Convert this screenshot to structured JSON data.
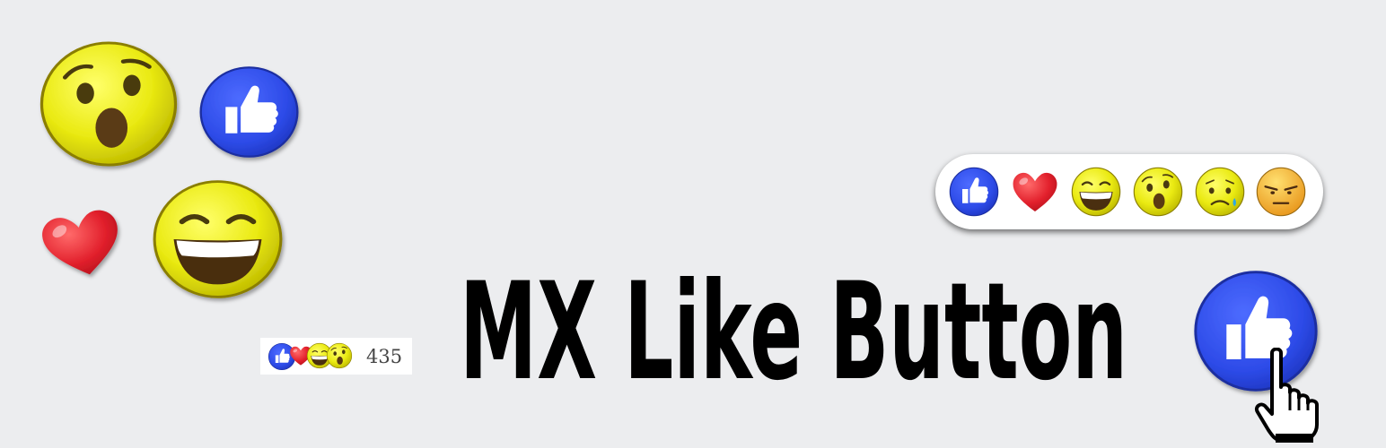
{
  "title": "MX Like Button",
  "counter": {
    "count": "435"
  },
  "colors": {
    "background": "#ecedef",
    "like_blue": "#2d4be8",
    "emoji_yellow": "#eaea12",
    "heart_red": "#e2202c",
    "angry_orange": "#f0b020"
  },
  "decor_icons": [
    "wow-emoji-icon",
    "like-thumb-icon",
    "heart-icon",
    "haha-emoji-icon"
  ],
  "reactions": [
    "like",
    "love",
    "haha",
    "wow",
    "sad",
    "angry"
  ],
  "big_button_icons": [
    "like-thumb-icon",
    "hand-cursor-icon"
  ]
}
